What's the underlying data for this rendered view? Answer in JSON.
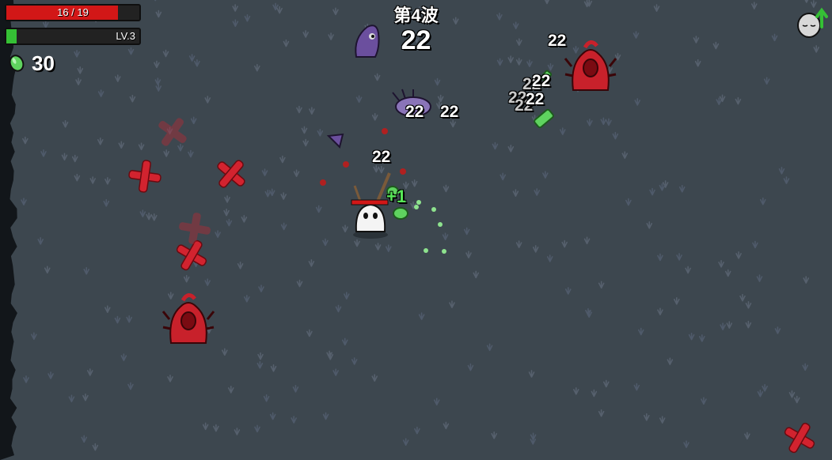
{
  "hud": {
    "health": {
      "current": 16,
      "max": 19,
      "text": "16 / 19",
      "color": "#d21717"
    },
    "experience": {
      "level_text": "LV.3",
      "progress": 0.08,
      "color": "#35c035"
    },
    "materials": {
      "count": "30",
      "icon": "material-icon"
    }
  },
  "wave": {
    "label": "第4波",
    "timer": "22"
  },
  "damage_numbers": [
    "22",
    "22",
    "22",
    "22",
    "22",
    "22",
    "22",
    "22",
    "22",
    "22"
  ],
  "heal_popup": "+1",
  "level_up": {
    "icon": "level-up-arrow-icon"
  },
  "colors": {
    "ground": "#3d474f",
    "enemy_red": "#c8212b",
    "enemy_purple": "#6b4f9e",
    "material_green": "#5fd35f"
  }
}
